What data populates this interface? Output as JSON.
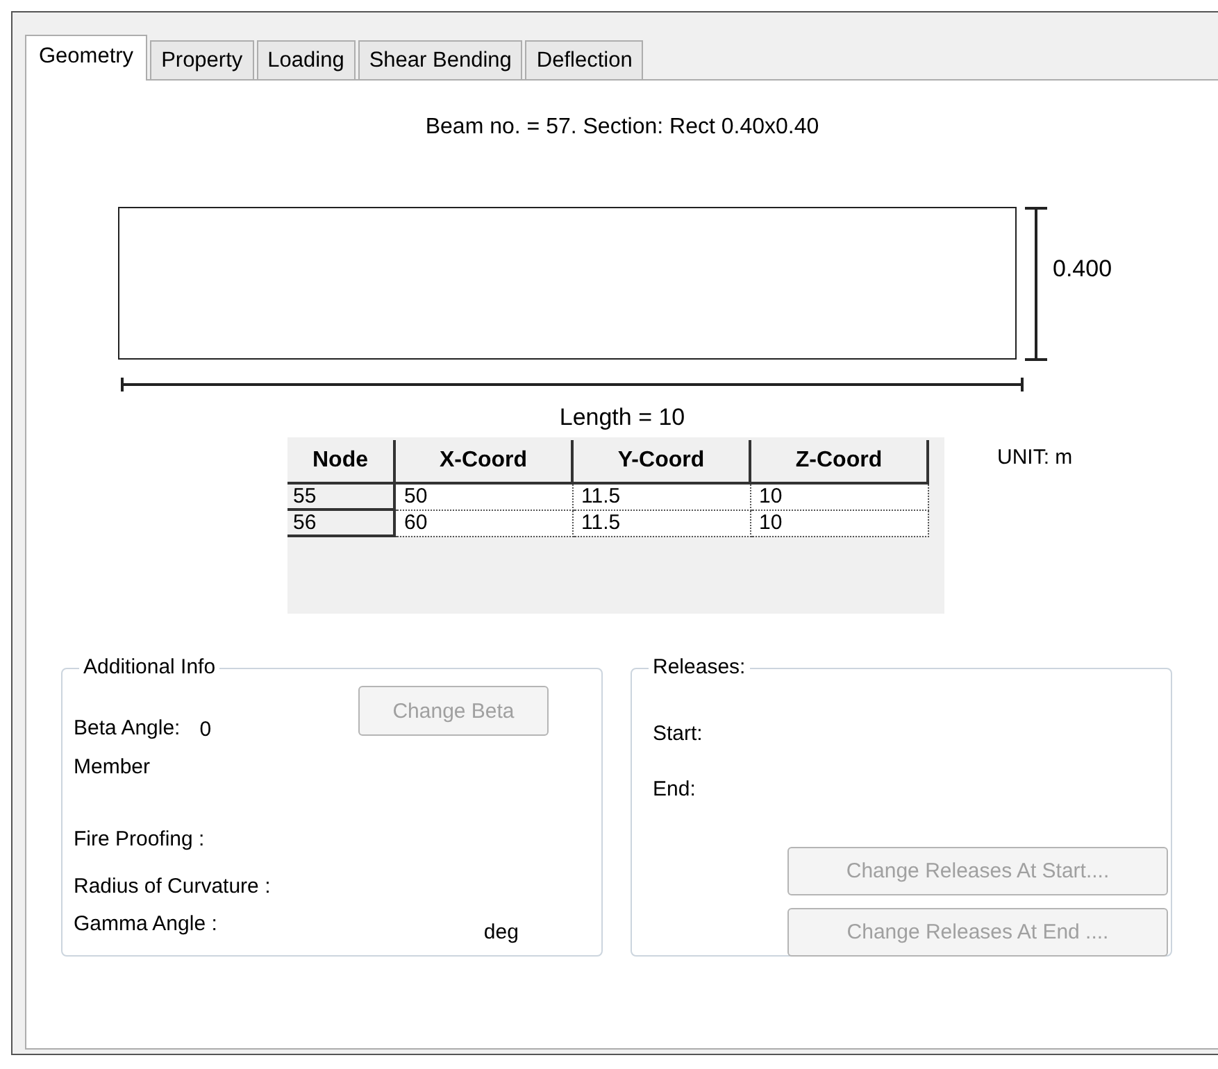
{
  "tabs": [
    {
      "label": "Geometry",
      "selected": true
    },
    {
      "label": "Property",
      "selected": false
    },
    {
      "label": "Loading",
      "selected": false
    },
    {
      "label": "Shear Bending",
      "selected": false
    },
    {
      "label": "Deflection",
      "selected": false
    }
  ],
  "beam": {
    "title": "Beam no. = 57. Section: Rect 0.40x0.40",
    "height_label": "0.400",
    "length_label": "Length = 10"
  },
  "nodes_table": {
    "columns": [
      "Node",
      "X-Coord",
      "Y-Coord",
      "Z-Coord"
    ],
    "rows": [
      [
        "55",
        "50",
        "11.5",
        "10"
      ],
      [
        "56",
        "60",
        "11.5",
        "10"
      ]
    ]
  },
  "unit_label": "UNIT: m",
  "additional_info": {
    "title": "Additional Info",
    "beta_label": "Beta Angle:",
    "beta_value": "0",
    "member_label": "Member",
    "fire_proofing_label": "Fire Proofing :",
    "radius_label": "Radius of Curvature :",
    "gamma_label": "Gamma Angle :",
    "gamma_unit": "deg",
    "change_beta_button": {
      "label": "Change Beta",
      "disabled": true
    }
  },
  "releases": {
    "title": "Releases:",
    "start_label": "Start:",
    "end_label": "End:",
    "buttons": [
      {
        "label": "Change Releases At Start....",
        "disabled": true
      },
      {
        "label": "Change Releases At End ....",
        "disabled": true
      }
    ]
  }
}
